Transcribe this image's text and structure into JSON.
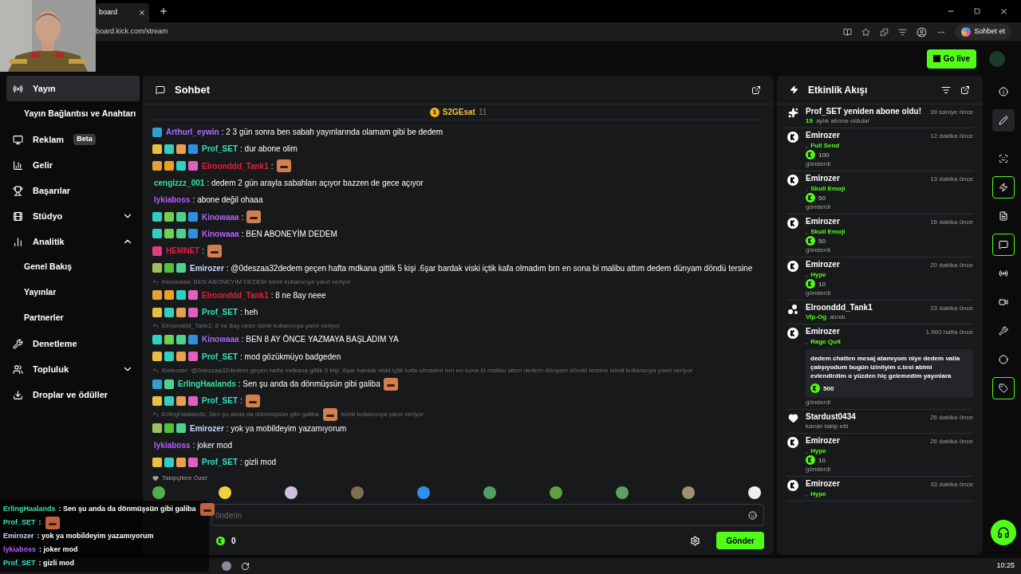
{
  "browser": {
    "tab_title": "board",
    "address": "board.kick.com/stream",
    "copilot": "Sohbet et"
  },
  "header": {
    "go_live": "Go live"
  },
  "sidebar": {
    "items": [
      {
        "label": "Yayın",
        "selected": true,
        "children": [
          {
            "label": "Yayın Bağlantısı ve Anahtarı",
            "selected": false
          }
        ]
      },
      {
        "label": "Reklam",
        "badge": "Beta",
        "selected": false
      },
      {
        "label": "Gelir",
        "selected": false
      },
      {
        "label": "Başarılar",
        "selected": false
      },
      {
        "label": "Stüdyo",
        "selected": false,
        "expanded": false
      },
      {
        "label": "Analitik",
        "selected": false,
        "expanded": true,
        "children": [
          {
            "label": "Genel Bakış",
            "selected": false
          },
          {
            "label": "Yayınlar",
            "selected": false
          },
          {
            "label": "Partnerler",
            "selected": false
          }
        ]
      },
      {
        "label": "Denetleme",
        "selected": false
      },
      {
        "label": "Topluluk",
        "selected": false,
        "expanded": false
      },
      {
        "label": "Droplar ve ödüller",
        "selected": false
      }
    ]
  },
  "chat": {
    "title": "Sohbet",
    "pinned": {
      "rank": "1",
      "user": "S2GEsat",
      "count": "11"
    },
    "messages": [
      {
        "kind": "message",
        "badges": [
          {
            "color": "#2fa0d0"
          }
        ],
        "user": "Arthurl_eywin",
        "color": "#a970ff",
        "text": ": 2 3 gün sonra ben sabah yayınlarında olamam gibi be dedem",
        "emote": false
      },
      {
        "kind": "message",
        "badges": [
          {
            "color": "#e8c040"
          },
          {
            "color": "#2fd0c0"
          },
          {
            "color": "#e8a050"
          },
          {
            "color": "#2f90e0"
          }
        ],
        "user": "Prof_SET",
        "color": "#35e0c0",
        "text": ": dur abone olim",
        "emote": false
      },
      {
        "kind": "message",
        "badges": [
          {
            "color": "#e8a030"
          },
          {
            "color": "#f0a020"
          },
          {
            "color": "#2fd0c0"
          },
          {
            "color": "#e060c0"
          }
        ],
        "user": "Elroonddd_Tank1",
        "color": "#e0203f",
        "text": ":",
        "emote": true
      },
      {
        "kind": "message",
        "user": "cengizzz_001",
        "color": "#35e0a8",
        "text": ": dedem 2 gün arayla sabahları açıyor bazzen de gece açıyor",
        "emote": false
      },
      {
        "kind": "message",
        "user": "lykiaboss",
        "color": "#b45cff",
        "text": ": abone değil ohaaa",
        "emote": false
      },
      {
        "kind": "message",
        "badges": [
          {
            "color": "#2fd0c0"
          },
          {
            "color": "#70d050"
          },
          {
            "color": "#50d090"
          },
          {
            "color": "#2f90e0"
          }
        ],
        "user": "Kinowaaa",
        "color": "#b060ff",
        "text": ":",
        "emote": true
      },
      {
        "kind": "message",
        "badges": [
          {
            "color": "#2fd0c0"
          },
          {
            "color": "#70d050"
          },
          {
            "color": "#50d090"
          },
          {
            "color": "#2f90e0"
          }
        ],
        "user": "Kinowaaa",
        "color": "#b060ff",
        "text": ": BEN ABONEYİM DEDEM",
        "emote": false
      },
      {
        "kind": "message",
        "badges": [
          {
            "color": "#e04080"
          }
        ],
        "user": "HEMNET",
        "color": "#e0203f",
        "text": ":",
        "emote": true
      },
      {
        "kind": "message",
        "badges": [
          {
            "color": "#a0c060"
          },
          {
            "color": "#50c040"
          },
          {
            "color": "#50d090"
          }
        ],
        "user": "Emirozer",
        "color": "#c8d8ff",
        "text": ": @0deszaa32dedem geçen hafta mdkana gittik 5 kişi .6şar bardak viski içtik kafa olmadım brn en sona bi malibu attım dedem dünyam döndü tersine",
        "emote": false
      },
      {
        "kind": "reply",
        "parts": [
          "Kinowaaa: BEN ABONEYİM DEDEM isimli kullanıcıya yanıt veriyor"
        ]
      },
      {
        "kind": "message",
        "badges": [
          {
            "color": "#e8a030"
          },
          {
            "color": "#f0a020"
          },
          {
            "color": "#2fd0c0"
          },
          {
            "color": "#e060c0"
          }
        ],
        "user": "Elroonddd_Tank1",
        "color": "#e0203f",
        "text": ": 8 ne 8ay neee",
        "emote": false
      },
      {
        "kind": "message",
        "badges": [
          {
            "color": "#e8c040"
          },
          {
            "color": "#2fd0c0"
          },
          {
            "color": "#e8a050"
          },
          {
            "color": "#e060c0"
          }
        ],
        "user": "Prof_SET",
        "color": "#35e0c0",
        "text": ": heh",
        "emote": false
      },
      {
        "kind": "reply",
        "parts": [
          "Elroonddd_Tank1: 8 ne 8ay neee isimli kullanıcıya yanıt veriyor"
        ]
      },
      {
        "kind": "message",
        "badges": [
          {
            "color": "#2fd0c0"
          },
          {
            "color": "#70d050"
          },
          {
            "color": "#50d090"
          },
          {
            "color": "#2f90e0"
          }
        ],
        "user": "Kinowaaa",
        "color": "#b060ff",
        "text": ": BEN 8 AY ÖNCE YAZMAYA BAŞLADIM YA",
        "emote": false
      },
      {
        "kind": "message",
        "badges": [
          {
            "color": "#e8c040"
          },
          {
            "color": "#2fd0c0"
          },
          {
            "color": "#e8a050"
          },
          {
            "color": "#e060c0"
          }
        ],
        "user": "Prof_SET",
        "color": "#35e0c0",
        "text": ": mod gözükmüyo badgeden",
        "emote": false
      },
      {
        "kind": "reply",
        "parts": [
          "Emirozer: @0deszaa32dedem geçen hafta mdkana gittik 5 kişi .6şar bardak viski içtik kafa olmadım brn en sona bi malibu attım dedem dünyam döndü tersine isimli kullanıcıya yanıt veriyor"
        ]
      },
      {
        "kind": "message",
        "badges": [
          {
            "color": "#2fa0d0"
          },
          {
            "color": "#50d090"
          }
        ],
        "user": "ErlingHaalands",
        "color": "#35e0a0",
        "text": ": Sen şu anda da dönmüşsün gibi galiba",
        "emote": true
      },
      {
        "kind": "message",
        "badges": [
          {
            "color": "#e8c040"
          },
          {
            "color": "#2fd0c0"
          },
          {
            "color": "#e8a050"
          },
          {
            "color": "#e060c0"
          }
        ],
        "user": "Prof_SET",
        "color": "#35e0c0",
        "text": ":",
        "emote": true
      },
      {
        "kind": "reply",
        "parts": [
          "ErlingHaalands: Sen şu anda da dönmüşsün gibi galiba",
          "isimli kullanıcıya yanıt veriyor"
        ]
      },
      {
        "kind": "message",
        "badges": [
          {
            "color": "#a0c060"
          },
          {
            "color": "#50c040"
          },
          {
            "color": "#50d090"
          }
        ],
        "user": "Emirozer",
        "color": "#c8d8ff",
        "text": ": yok ya mobildeyim yazamıyorum",
        "emote": false
      },
      {
        "kind": "message",
        "user": "lykiaboss",
        "color": "#b45cff",
        "text": ": joker mod",
        "emote": false
      },
      {
        "kind": "message",
        "badges": [
          {
            "color": "#e8c040"
          },
          {
            "color": "#2fd0c0"
          },
          {
            "color": "#e8a050"
          },
          {
            "color": "#e060c0"
          }
        ],
        "user": "Prof_SET",
        "color": "#35e0c0",
        "text": ": gizli mod",
        "emote": false
      }
    ],
    "emote_section": "Takipçilere Özel",
    "input_placeholder": "önderin",
    "balance": "0",
    "send": "Gönder"
  },
  "events": {
    "title": "Etkinlik Akışı",
    "items": [
      {
        "kind": "resub",
        "title": "Prof_SET yeniden abone oldu!",
        "time": "39 saniye önce",
        "count": "19",
        "detail": "aylık abone oldular"
      },
      {
        "kind": "kicks",
        "name": "Emirozer",
        "time": "12 dakika önce",
        "prefix": ",",
        "gift": "Full Send",
        "amount": "100",
        "sent": "gönderdi"
      },
      {
        "kind": "kicks",
        "name": "Emirozer",
        "time": "13 dakika önce",
        "prefix": ",",
        "gift": "Skull Emoji",
        "amount": "50",
        "sent": "gönderdi"
      },
      {
        "kind": "kicks",
        "name": "Emirozer",
        "time": "16 dakika önce",
        "prefix": ",",
        "gift": "Skull Emoji",
        "amount": "50",
        "sent": "gönderdi"
      },
      {
        "kind": "kicks",
        "name": "Emirozer",
        "time": "20 dakika önce",
        "prefix": ",",
        "gift": "Hype",
        "amount": "10",
        "sent": "gönderdi"
      },
      {
        "kind": "vip",
        "name": "Elroonddd_Tank1",
        "time": "23 dakika önce",
        "gift": "Vİp-Og",
        "detail": "alındı"
      },
      {
        "kind": "kicks",
        "name": "Emirozer",
        "time": "1.960 hafta önce",
        "prefix": ",",
        "gift": "Rage Quit",
        "message": "dedem chatten mesaj atamıyom niye dedem valla çalışıyodum bugün izinliyim c.tesi abimi evlendirdim o yüzden hiç gelemedim yayınlara",
        "amount": "500",
        "sent": "gönderdi"
      },
      {
        "kind": "follow",
        "name": "Stardust0434",
        "time": "26 dakika önce",
        "detail": "kanalı takip etti"
      },
      {
        "kind": "kicks",
        "name": "Emirozer",
        "time": "26 dakika önce",
        "prefix": ",",
        "gift": "Hype",
        "amount": "10",
        "sent": "gönderdi"
      },
      {
        "kind": "kicks",
        "name": "Emirozer",
        "time": "33 dakika önce",
        "prefix": ",",
        "gift": "Hype"
      }
    ]
  },
  "rail": [
    {
      "active": false,
      "highlighted": false
    },
    {
      "active": false,
      "highlighted": true
    },
    {
      "active": false,
      "highlighted": false
    },
    {
      "active": true,
      "highlighted": false
    },
    {
      "active": false,
      "highlighted": false
    },
    {
      "active": true,
      "highlighted": false
    },
    {
      "active": false,
      "highlighted": false
    },
    {
      "active": false,
      "highlighted": false
    },
    {
      "active": false,
      "highlighted": false
    },
    {
      "active": false,
      "highlighted": false
    },
    {
      "active": true,
      "highlighted": false
    }
  ],
  "overlay_chat": [
    {
      "user": "ErlingHaalands",
      "color": "#35e0a0",
      "text": " : Sen şu anda da dönmüşsün gibi galiba",
      "emote": true
    },
    {
      "user": "Prof_SET",
      "color": "#35e0c0",
      "text": " :",
      "emote": true
    },
    {
      "user": "Emirozer",
      "color": "#c8d8ff",
      "text": " : yok ya mobildeyim yazamıyorum",
      "emote": false
    },
    {
      "user": "lykiaboss",
      "color": "#b45cff",
      "text": " : joker mod",
      "emote": false
    },
    {
      "user": "Prof_SET",
      "color": "#35e0c0",
      "text": " : gizli mod",
      "emote": false
    }
  ],
  "taskbar": {
    "time": "10:25"
  }
}
